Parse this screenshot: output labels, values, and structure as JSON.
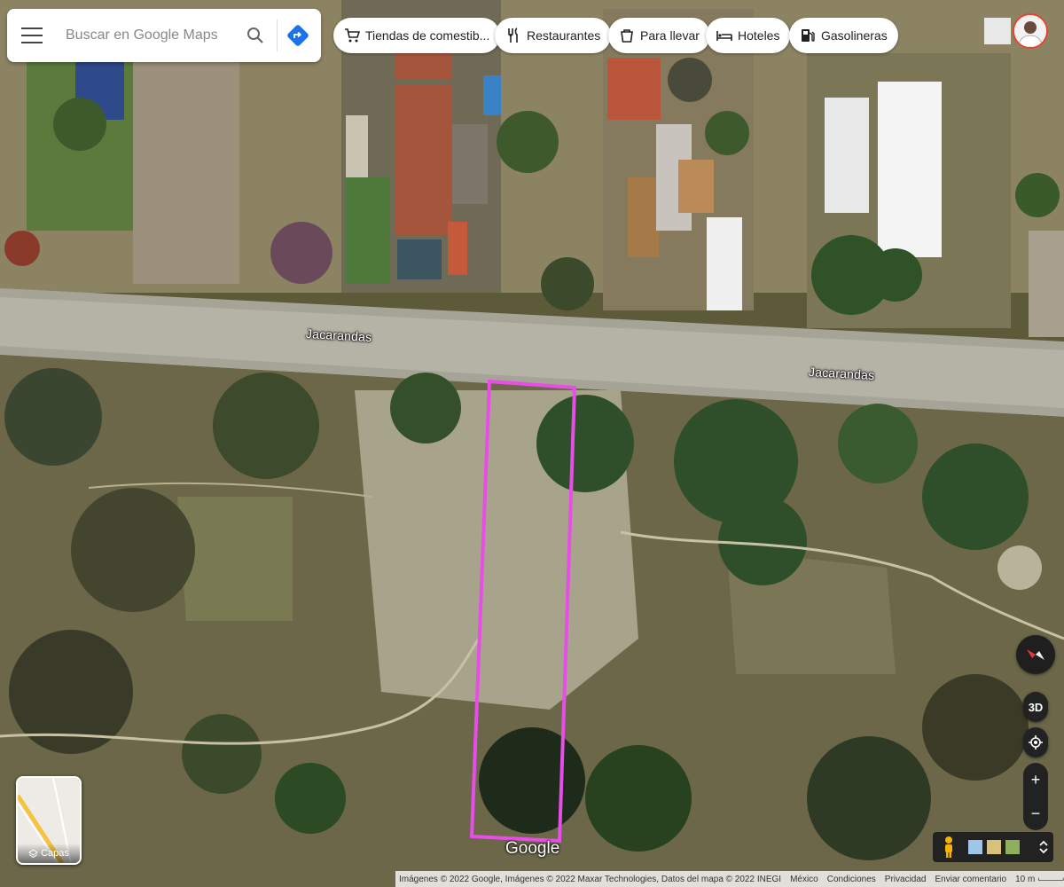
{
  "search": {
    "placeholder": "Buscar en Google Maps"
  },
  "chips": [
    {
      "label": "Tiendas de comestib...",
      "icon": "cart-icon"
    },
    {
      "label": "Restaurantes",
      "icon": "fork-knife-icon"
    },
    {
      "label": "Para llevar",
      "icon": "takeout-icon"
    },
    {
      "label": "Hoteles",
      "icon": "bed-icon"
    },
    {
      "label": "Gasolineras",
      "icon": "gas-pump-icon"
    }
  ],
  "map": {
    "roads": [
      "Jacarandas",
      "Jacarandas"
    ],
    "highlight_color": "#e84de8"
  },
  "controls": {
    "three_d": "3D",
    "zoom_in": "+",
    "zoom_out": "−",
    "layers_label": "Capas"
  },
  "google_logo": "Google",
  "footer": {
    "attribution": "Imágenes © 2022 Google, Imágenes © 2022 Maxar Technologies, Datos del mapa © 2022 INEGI",
    "country": "México",
    "terms": "Condiciones",
    "privacy": "Privacidad",
    "feedback": "Enviar comentario",
    "scale": "10 m"
  }
}
